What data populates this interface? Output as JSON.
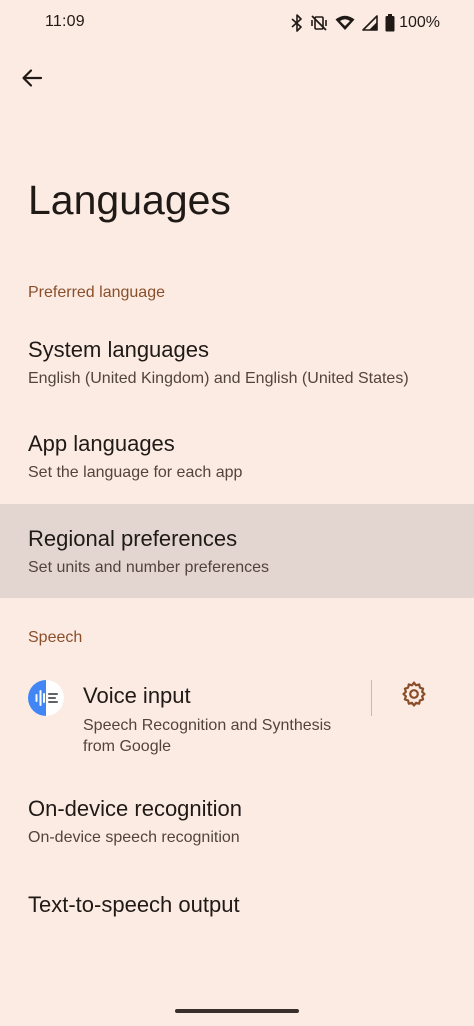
{
  "status_bar": {
    "time": "11:09",
    "battery_level": "100%",
    "icons": [
      "bluetooth-icon",
      "vibrate-off-icon",
      "wifi-icon",
      "signal-icon",
      "battery-icon"
    ]
  },
  "toolbar": {
    "back_icon": "arrow-back-icon"
  },
  "page": {
    "title": "Languages"
  },
  "sections": {
    "preferred_language": {
      "header": "Preferred language",
      "items": [
        {
          "title": "System languages",
          "summary": "English (United Kingdom) and English (United States)"
        },
        {
          "title": "App languages",
          "summary": "Set the language for each app"
        },
        {
          "title": "Regional preferences",
          "summary": "Set units and number preferences"
        }
      ]
    },
    "speech": {
      "header": "Speech",
      "voice_input": {
        "title": "Voice input",
        "summary": "Speech Recognition and Synthesis from Google",
        "icon": "google-speech-services-icon",
        "settings_icon": "gear-icon"
      },
      "items": [
        {
          "title": "On-device recognition",
          "summary": "On-device speech recognition"
        },
        {
          "title": "Text-to-speech output"
        }
      ]
    }
  },
  "colors": {
    "background": "#fcebe3",
    "accent": "#8a4f2a",
    "highlight": "#e3d6d0",
    "google_blue": "#4285f4"
  }
}
